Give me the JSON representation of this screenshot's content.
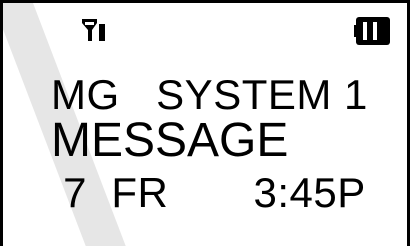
{
  "status_bar": {
    "signal_icon": "antenna-signal-icon",
    "battery_icon": "battery-full-icon"
  },
  "display": {
    "line1": "MG   SYSTEM 1",
    "line2": "MESSAGE",
    "line3": " 7  FR       3:45P"
  },
  "colors": {
    "text": "#000000",
    "background": "#ffffff",
    "glare": "#e6e6e6"
  }
}
